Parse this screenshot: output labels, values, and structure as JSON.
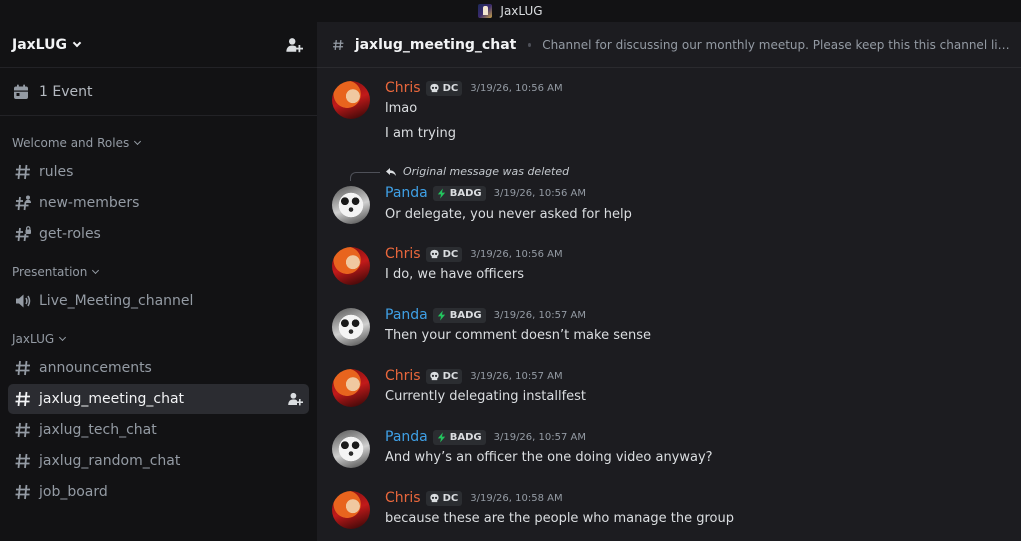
{
  "window": {
    "title": "JaxLUG"
  },
  "server": {
    "name": "JaxLUG"
  },
  "events": {
    "label": "1 Event"
  },
  "categories": {
    "welcome": "Welcome and Roles",
    "presentation": "Presentation",
    "jaxlug": "JaxLUG"
  },
  "channels": {
    "rules": "rules",
    "new_members": "new-members",
    "get_roles": "get-roles",
    "live_meeting": "Live_Meeting_channel",
    "announcements": "announcements",
    "meeting_chat": "jaxlug_meeting_chat",
    "tech_chat": "jaxlug_tech_chat",
    "random_chat": "jaxlug_random_chat",
    "job_board": "job_board"
  },
  "header": {
    "channel_name": "jaxlug_meeting_chat",
    "topic": "Channel for discussing our monthly meetup. Please keep this this channel limited to meetup-related discussion."
  },
  "messages": [
    {
      "author": "Chris",
      "tag": "DC",
      "tag_icon": "skull-icon",
      "time": "3/19/26, 10:56 AM",
      "lines": [
        "lmao",
        "I am trying"
      ]
    },
    {
      "author": "Panda",
      "tag": "BADG",
      "tag_icon": "lightning-icon",
      "time": "3/19/26, 10:56 AM",
      "reply_to": "Original message was deleted",
      "lines": [
        "Or delegate, you never asked for help"
      ]
    },
    {
      "author": "Chris",
      "tag": "DC",
      "tag_icon": "skull-icon",
      "time": "3/19/26, 10:56 AM",
      "lines": [
        "I do, we have officers"
      ]
    },
    {
      "author": "Panda",
      "tag": "BADG",
      "tag_icon": "lightning-icon",
      "time": "3/19/26, 10:57 AM",
      "lines": [
        "Then your comment doesn’t make sense"
      ]
    },
    {
      "author": "Chris",
      "tag": "DC",
      "tag_icon": "skull-icon",
      "time": "3/19/26, 10:57 AM",
      "lines": [
        "Currently delegating installfest"
      ]
    },
    {
      "author": "Panda",
      "tag": "BADG",
      "tag_icon": "lightning-icon",
      "time": "3/19/26, 10:57 AM",
      "lines": [
        "And why’s an officer the one doing video anyway?"
      ]
    },
    {
      "author": "Chris",
      "tag": "DC",
      "tag_icon": "skull-icon",
      "time": "3/19/26, 10:58 AM",
      "lines": [
        "because these are the people who manage the group"
      ]
    }
  ],
  "colors": {
    "chris_name": "#e9673c",
    "panda_name": "#3fa0e6",
    "sidebar_bg": "#121214",
    "chat_bg": "#1c1c20",
    "active_channel_bg": "#2b2c31",
    "badg_lightning": "#23c55e"
  }
}
